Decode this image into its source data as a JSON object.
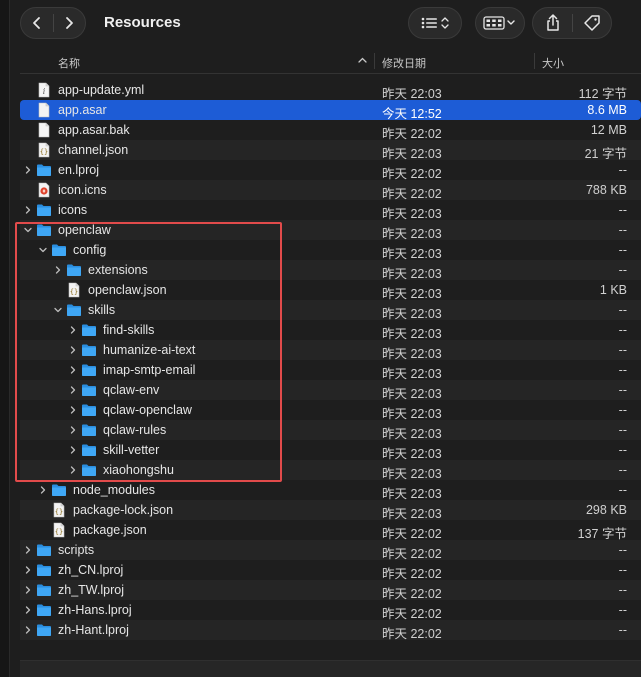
{
  "window": {
    "title": "Resources"
  },
  "columns": {
    "name": "名称",
    "modified": "修改日期",
    "size": "大小"
  },
  "colors": {
    "selection": "#1d5cd6",
    "folder": "#3fa7f5",
    "highlight": "#e24b4b"
  },
  "rows": [
    {
      "name": "app-update.yml",
      "date": "昨天 22:03",
      "size": "112 字节",
      "type": "doc",
      "indent": 0,
      "disclosure": "none"
    },
    {
      "name": "app.asar",
      "date": "今天 12:52",
      "size": "8.6 MB",
      "type": "file",
      "indent": 0,
      "disclosure": "none",
      "selected": true
    },
    {
      "name": "app.asar.bak",
      "date": "昨天 22:02",
      "size": "12 MB",
      "type": "file",
      "indent": 0,
      "disclosure": "none"
    },
    {
      "name": "channel.json",
      "date": "昨天 22:03",
      "size": "21 字节",
      "type": "json",
      "indent": 0,
      "disclosure": "none"
    },
    {
      "name": "en.lproj",
      "date": "昨天 22:02",
      "size": "--",
      "type": "folder",
      "indent": 0,
      "disclosure": "closed"
    },
    {
      "name": "icon.icns",
      "date": "昨天 22:02",
      "size": "788 KB",
      "type": "icns",
      "indent": 0,
      "disclosure": "none"
    },
    {
      "name": "icons",
      "date": "昨天 22:03",
      "size": "--",
      "type": "folder",
      "indent": 0,
      "disclosure": "closed"
    },
    {
      "name": "openclaw",
      "date": "昨天 22:03",
      "size": "--",
      "type": "folder",
      "indent": 0,
      "disclosure": "open"
    },
    {
      "name": "config",
      "date": "昨天 22:03",
      "size": "--",
      "type": "folder",
      "indent": 1,
      "disclosure": "open"
    },
    {
      "name": "extensions",
      "date": "昨天 22:03",
      "size": "--",
      "type": "folder",
      "indent": 2,
      "disclosure": "closed"
    },
    {
      "name": "openclaw.json",
      "date": "昨天 22:03",
      "size": "1 KB",
      "type": "json",
      "indent": 2,
      "disclosure": "none"
    },
    {
      "name": "skills",
      "date": "昨天 22:03",
      "size": "--",
      "type": "folder",
      "indent": 2,
      "disclosure": "open"
    },
    {
      "name": "find-skills",
      "date": "昨天 22:03",
      "size": "--",
      "type": "folder",
      "indent": 3,
      "disclosure": "closed"
    },
    {
      "name": "humanize-ai-text",
      "date": "昨天 22:03",
      "size": "--",
      "type": "folder",
      "indent": 3,
      "disclosure": "closed"
    },
    {
      "name": "imap-smtp-email",
      "date": "昨天 22:03",
      "size": "--",
      "type": "folder",
      "indent": 3,
      "disclosure": "closed"
    },
    {
      "name": "qclaw-env",
      "date": "昨天 22:03",
      "size": "--",
      "type": "folder",
      "indent": 3,
      "disclosure": "closed"
    },
    {
      "name": "qclaw-openclaw",
      "date": "昨天 22:03",
      "size": "--",
      "type": "folder",
      "indent": 3,
      "disclosure": "closed"
    },
    {
      "name": "qclaw-rules",
      "date": "昨天 22:03",
      "size": "--",
      "type": "folder",
      "indent": 3,
      "disclosure": "closed"
    },
    {
      "name": "skill-vetter",
      "date": "昨天 22:03",
      "size": "--",
      "type": "folder",
      "indent": 3,
      "disclosure": "closed"
    },
    {
      "name": "xiaohongshu",
      "date": "昨天 22:03",
      "size": "--",
      "type": "folder",
      "indent": 3,
      "disclosure": "closed"
    },
    {
      "name": "node_modules",
      "date": "昨天 22:03",
      "size": "--",
      "type": "folder",
      "indent": 1,
      "disclosure": "closed"
    },
    {
      "name": "package-lock.json",
      "date": "昨天 22:03",
      "size": "298 KB",
      "type": "json",
      "indent": 1,
      "disclosure": "none"
    },
    {
      "name": "package.json",
      "date": "昨天 22:02",
      "size": "137 字节",
      "type": "json",
      "indent": 1,
      "disclosure": "none"
    },
    {
      "name": "scripts",
      "date": "昨天 22:02",
      "size": "--",
      "type": "folder",
      "indent": 0,
      "disclosure": "closed"
    },
    {
      "name": "zh_CN.lproj",
      "date": "昨天 22:02",
      "size": "--",
      "type": "folder",
      "indent": 0,
      "disclosure": "closed"
    },
    {
      "name": "zh_TW.lproj",
      "date": "昨天 22:02",
      "size": "--",
      "type": "folder",
      "indent": 0,
      "disclosure": "closed"
    },
    {
      "name": "zh-Hans.lproj",
      "date": "昨天 22:02",
      "size": "--",
      "type": "folder",
      "indent": 0,
      "disclosure": "closed"
    },
    {
      "name": "zh-Hant.lproj",
      "date": "昨天 22:02",
      "size": "--",
      "type": "folder",
      "indent": 0,
      "disclosure": "closed"
    }
  ]
}
